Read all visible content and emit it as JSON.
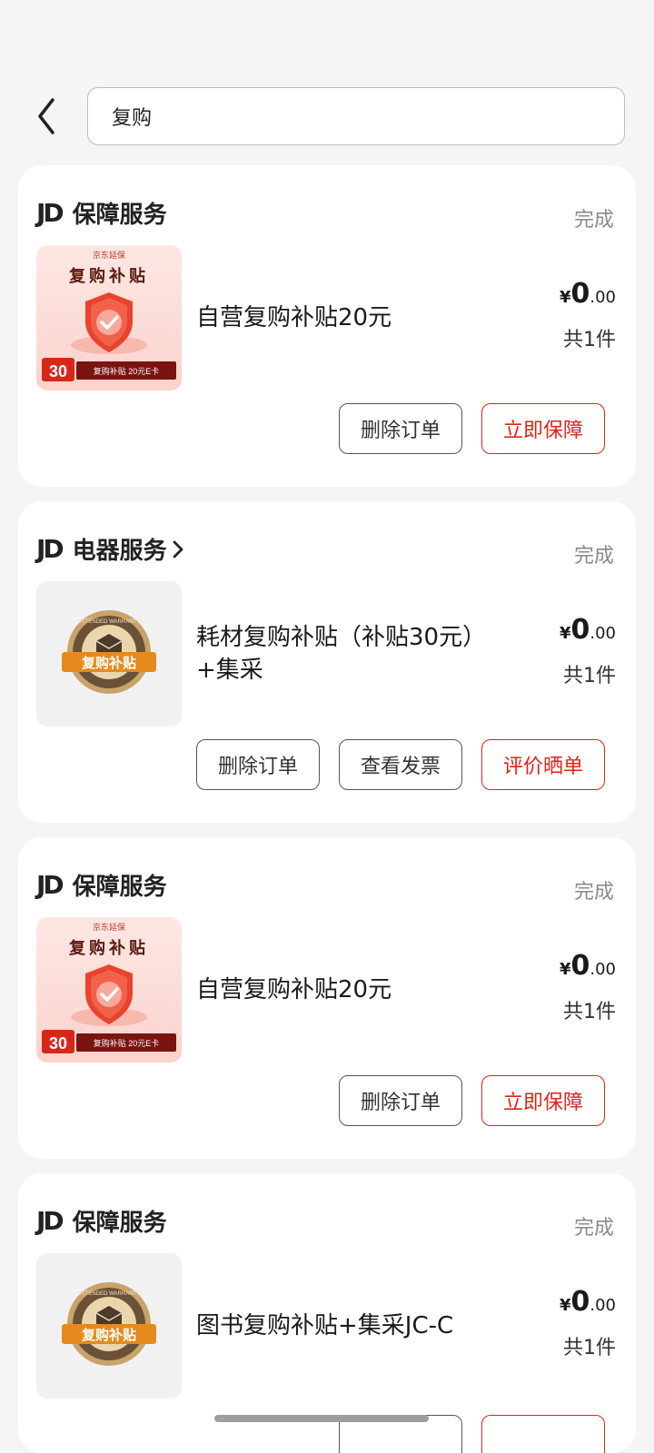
{
  "search": {
    "value": "复购"
  },
  "orders": [
    {
      "shop_logo": "JD",
      "shop_name": "保障服务",
      "has_arrow": false,
      "status": "完成",
      "thumb": {
        "type": "shield",
        "brand": "京东延保",
        "title": "复购补贴",
        "badge_num": "30",
        "badge_text": "复购补贴 20元E卡"
      },
      "product_name": "自营复购补贴20元",
      "price_symbol": "¥",
      "price_int": "0",
      "price_dec": ".00",
      "quantity": "共1件",
      "buttons": [
        {
          "label": "删除订单",
          "style": "normal"
        },
        {
          "label": "立即保障",
          "style": "red"
        }
      ]
    },
    {
      "shop_logo": "JD",
      "shop_name": "电器服务",
      "has_arrow": true,
      "status": "完成",
      "thumb": {
        "type": "seal",
        "ring_text": "EXTENDED WARRANTY",
        "title": "复购补贴"
      },
      "product_name": "耗材复购补贴（补贴30元）+集采",
      "price_symbol": "¥",
      "price_int": "0",
      "price_dec": ".00",
      "quantity": "共1件",
      "buttons": [
        {
          "label": "删除订单",
          "style": "normal"
        },
        {
          "label": "查看发票",
          "style": "normal"
        },
        {
          "label": "评价晒单",
          "style": "red"
        }
      ]
    },
    {
      "shop_logo": "JD",
      "shop_name": "保障服务",
      "has_arrow": false,
      "status": "完成",
      "thumb": {
        "type": "shield",
        "brand": "京东延保",
        "title": "复购补贴",
        "badge_num": "30",
        "badge_text": "复购补贴 20元E卡"
      },
      "product_name": "自营复购补贴20元",
      "price_symbol": "¥",
      "price_int": "0",
      "price_dec": ".00",
      "quantity": "共1件",
      "buttons": [
        {
          "label": "删除订单",
          "style": "normal"
        },
        {
          "label": "立即保障",
          "style": "red"
        }
      ]
    },
    {
      "shop_logo": "JD",
      "shop_name": "保障服务",
      "has_arrow": false,
      "status": "完成",
      "thumb": {
        "type": "seal",
        "ring_text": "EXTENDED WARRANTY",
        "title": "复购补贴"
      },
      "product_name": "图书复购补贴+集采JC-C",
      "price_symbol": "¥",
      "price_int": "0",
      "price_dec": ".00",
      "quantity": "共1件",
      "buttons": []
    }
  ]
}
